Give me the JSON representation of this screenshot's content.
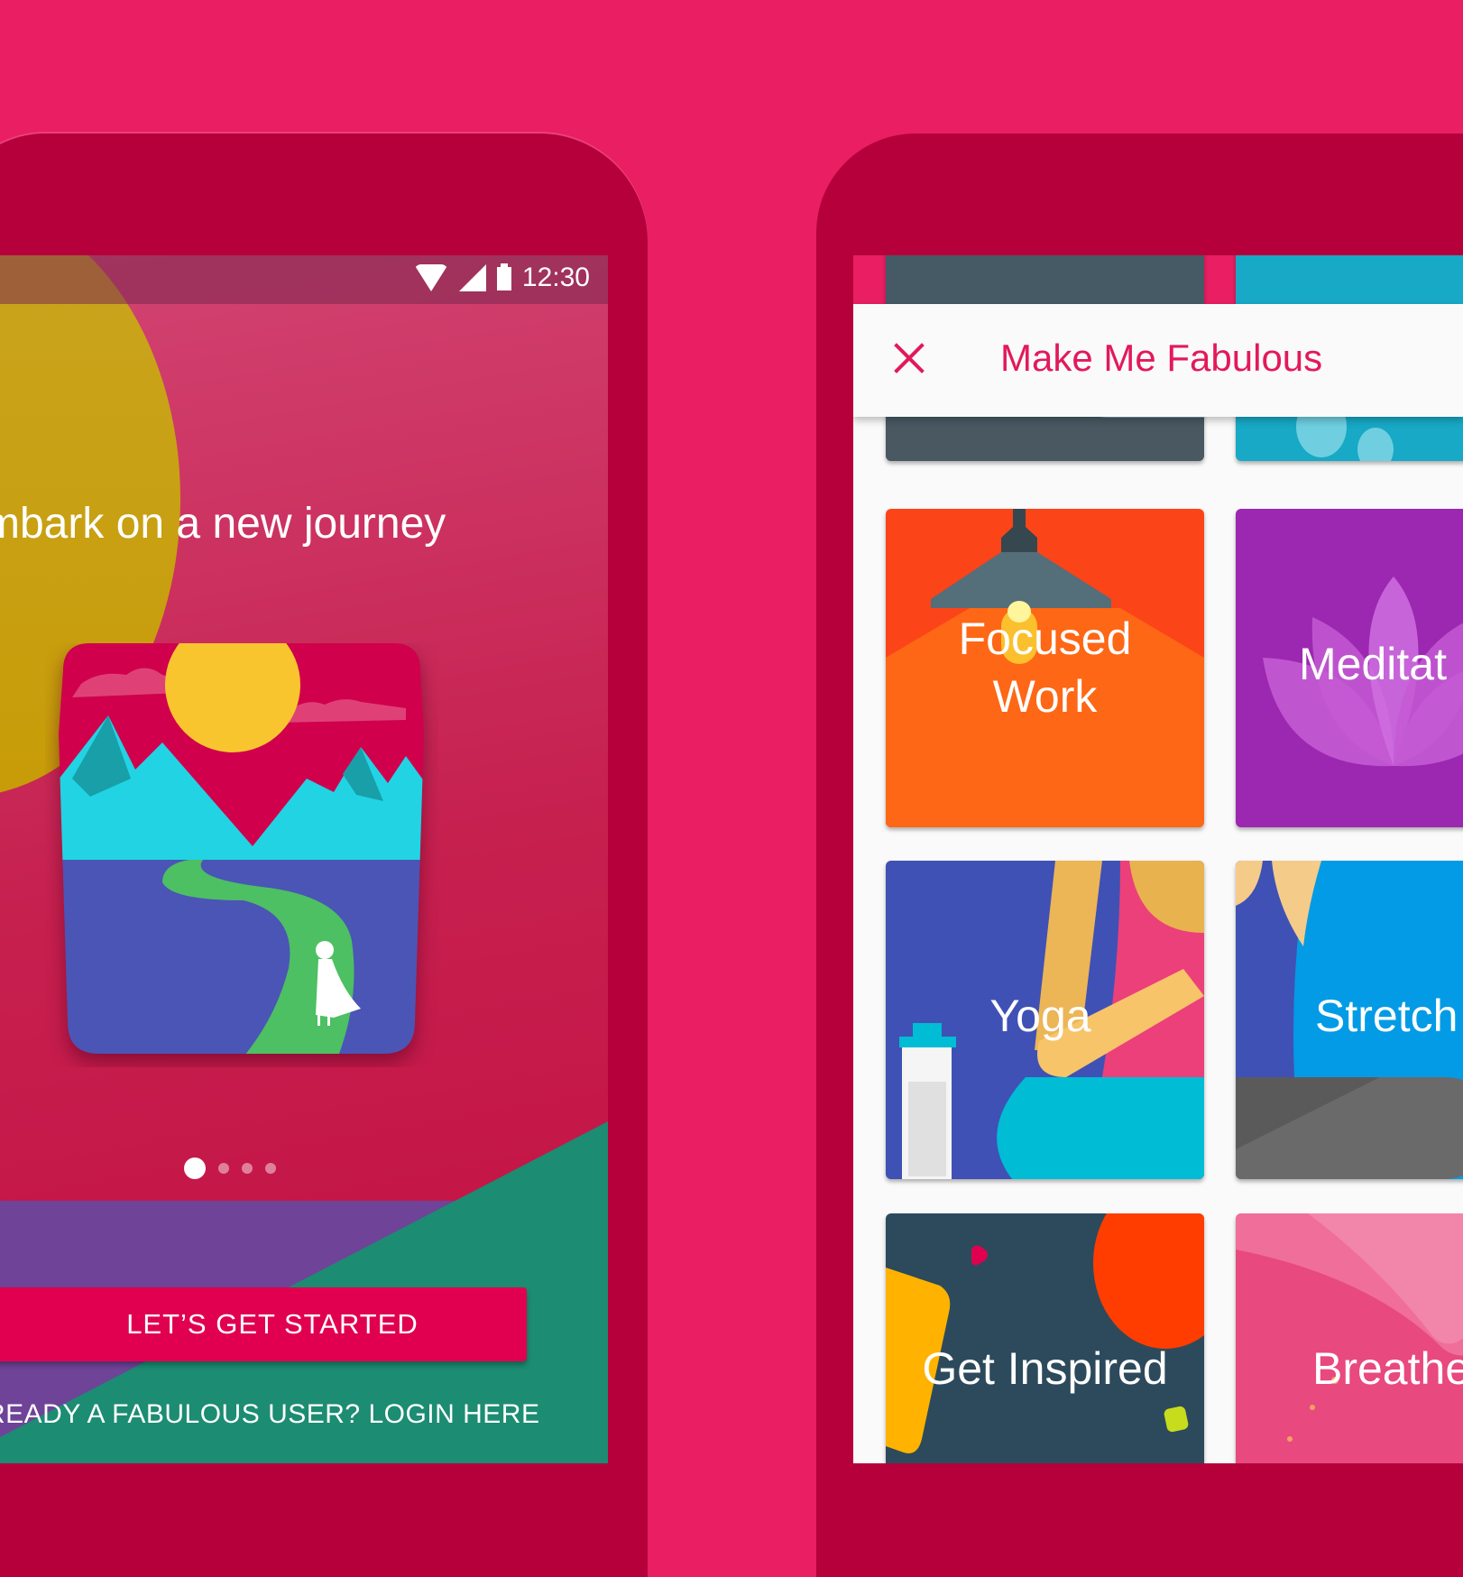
{
  "background_color": "#e91e63",
  "left_phone": {
    "status_bar": {
      "time": "12:30",
      "icons": [
        "wifi-icon",
        "cell-signal-icon",
        "battery-icon"
      ]
    },
    "headline": "mbark on a new journey",
    "illustration": "mountain-landscape-with-path-and-figure",
    "pager": {
      "total_dots": 4,
      "active_index": 0
    },
    "primary_button": "LET’S GET STARTED",
    "login_link": "READY A FABULOUS USER? LOGIN HERE",
    "colors": {
      "button": "#e0004f",
      "purple": "#6f4398",
      "green": "#1c8c72",
      "sun": "#f9c52f"
    }
  },
  "right_phone": {
    "status_bar": {
      "icons": [
        "wifi-icon",
        "cell-signal-icon"
      ]
    },
    "toolbar": {
      "close_icon": "close-icon",
      "title": "Make Me Fabulous",
      "title_color": "#e2195b"
    },
    "cards": [
      {
        "label": "",
        "color": "#455a64"
      },
      {
        "label": "",
        "color": "#17a9c6"
      },
      {
        "label": "Focused\nWork",
        "line1": "Focused",
        "line2": "Work",
        "color": "#ff5722"
      },
      {
        "label": "Meditat",
        "color": "#9c27b0"
      },
      {
        "label": "Yoga",
        "color": "#3f51b5"
      },
      {
        "label": "Stretch",
        "color": "#039be5"
      },
      {
        "label": "Get Inspired",
        "color": "#2c4a5c"
      },
      {
        "label": "Breathe",
        "color": "#e8497e"
      }
    ]
  }
}
